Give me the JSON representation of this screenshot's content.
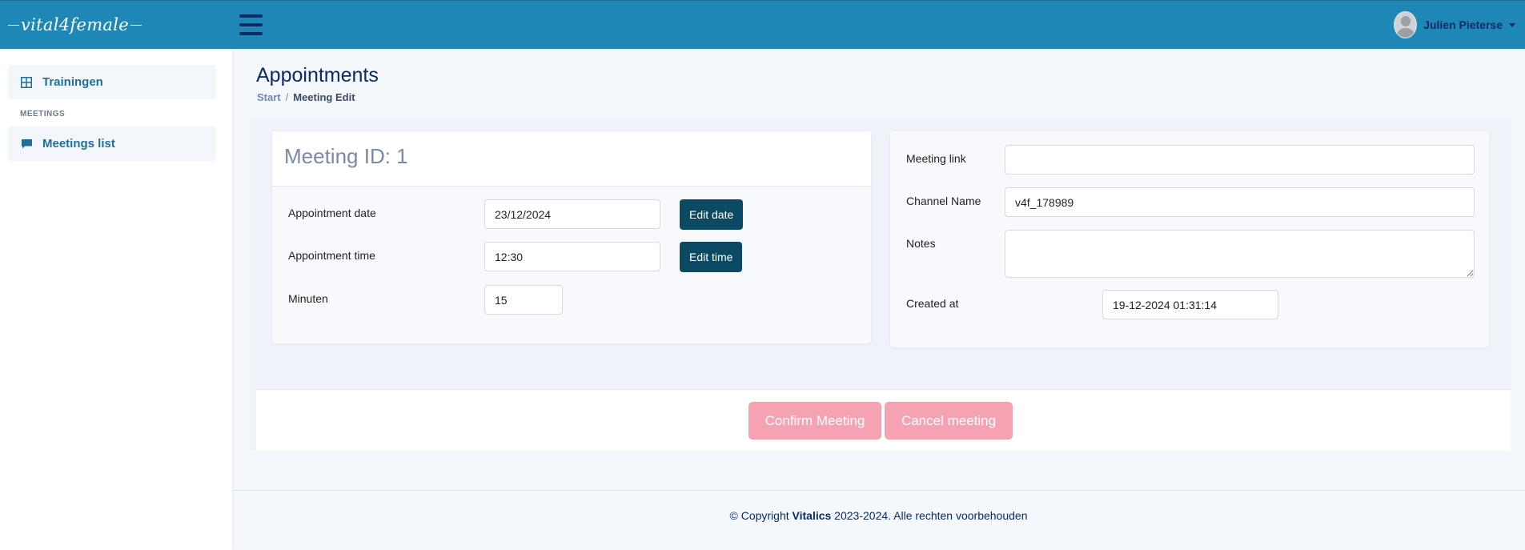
{
  "brand": {
    "logo_text": "vital4female"
  },
  "user": {
    "name": "Julien Pieterse"
  },
  "sidebar": {
    "items": [
      {
        "label": "Trainingen",
        "icon": "grid-icon"
      },
      {
        "label": "Meetings list",
        "icon": "chat-icon"
      }
    ],
    "section": "MEETINGS"
  },
  "page": {
    "title": "Appointments",
    "breadcrumb": {
      "start": "Start",
      "separator": "/",
      "current": "Meeting Edit"
    }
  },
  "meeting": {
    "heading": "Meeting ID: 1",
    "appointment_date_label": "Appointment date",
    "appointment_date_value": "23/12/2024",
    "edit_date_label": "Edit date",
    "appointment_time_label": "Appointment time",
    "appointment_time_value": "12:30",
    "edit_time_label": "Edit time",
    "minutes_label": "Minuten",
    "minutes_value": "15"
  },
  "details": {
    "meeting_link_label": "Meeting link",
    "meeting_link_value": "",
    "channel_name_label": "Channel Name",
    "channel_name_value": "v4f_178989",
    "notes_label": "Notes",
    "notes_value": "",
    "created_at_label": "Created at",
    "created_at_value": "19-12-2024 01:31:14"
  },
  "actions": {
    "confirm_label": "Confirm Meeting",
    "cancel_label": "Cancel meeting"
  },
  "footer": {
    "prefix": "© Copyright ",
    "company": "Vitalics",
    "suffix": " 2023-2024. Alle rechten voorbehouden"
  },
  "colors": {
    "topbar": "#1f87b5",
    "navy": "#0c2a66",
    "dark_button": "#0c4a63",
    "pink_button": "#f5a3b2"
  }
}
